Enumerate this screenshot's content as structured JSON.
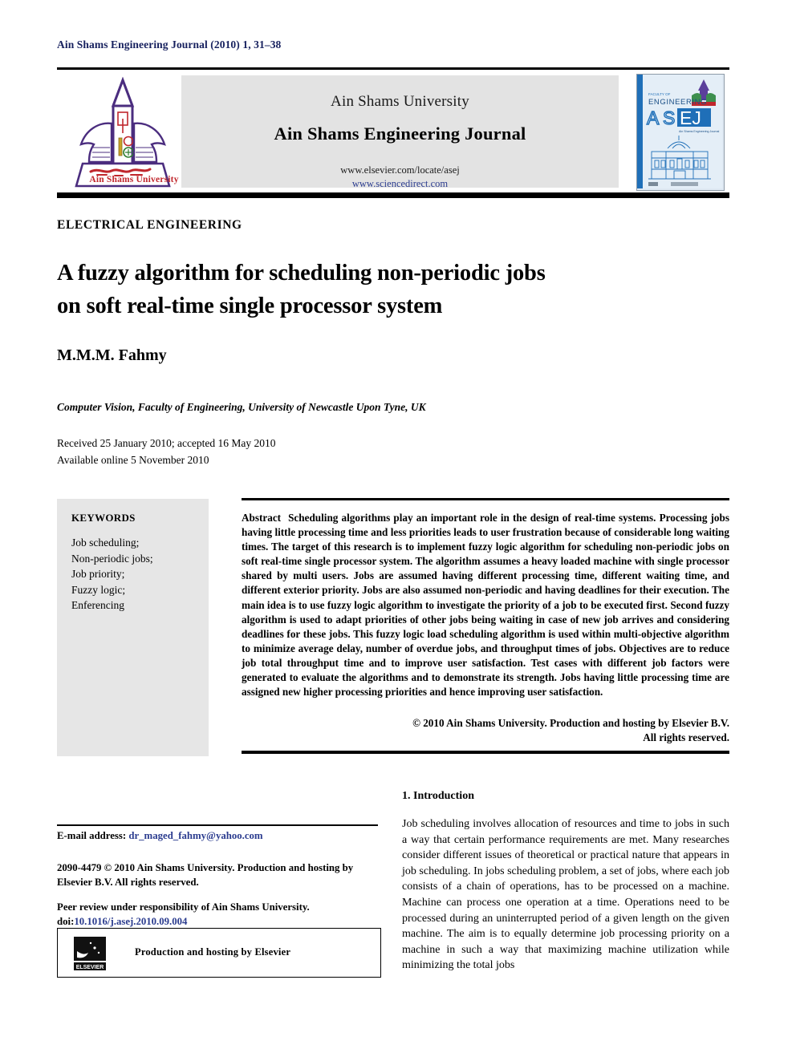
{
  "running_head": "Ain Shams Engineering Journal (2010) 1, 31–38",
  "masthead": {
    "university": "Ain Shams University",
    "journal": "Ain Shams Engineering Journal",
    "url_elsevier": "www.elsevier.com/locate/asej",
    "url_sciencedirect": "www.sciencedirect.com",
    "logo_caption_en": "Ain Shams University",
    "cover": {
      "kicker": "FACULTY OF",
      "subject": "ENGINEERING",
      "acronym_light": "AS",
      "acronym_dark": "EJ",
      "tagline": "Ain Shams Engineering Journal"
    }
  },
  "section_label": "ELECTRICAL ENGINEERING",
  "title_line1": "A fuzzy algorithm for scheduling non-periodic jobs",
  "title_line2": "on soft real-time single processor system",
  "authors": "M.M.M. Fahmy",
  "affiliation": "Computer Vision, Faculty of Engineering, University of Newcastle Upon Tyne, UK",
  "dates_line1": "Received 25 January 2010; accepted 16 May 2010",
  "dates_line2": "Available online 5 November 2010",
  "keywords": {
    "heading": "KEYWORDS",
    "items": [
      "Job scheduling;",
      "Non-periodic jobs;",
      "Job priority;",
      "Fuzzy logic;",
      "Enferencing"
    ]
  },
  "abstract": {
    "label": "Abstract",
    "text": "Scheduling algorithms play an important role in the design of real-time systems. Processing jobs having little processing time and less priorities leads to user frustration because of considerable long waiting times. The target of this research is to implement fuzzy logic algorithm for scheduling non-periodic jobs on soft real-time single processor system. The algorithm assumes a heavy loaded machine with single processor shared by multi users. Jobs are assumed having different processing time, different waiting time, and different exterior priority. Jobs are also assumed non-periodic and having deadlines for their execution. The main idea is to use fuzzy logic algorithm to investigate the priority of a job to be executed first. Second fuzzy algorithm is used to adapt priorities of other jobs being waiting in case of new job arrives and considering deadlines for these jobs. This fuzzy logic load scheduling algorithm is used within multi-objective algorithm to minimize average delay, number of overdue jobs, and throughput times of jobs. Objectives are to reduce job total throughput time and to improve user satisfaction. Test cases with different job factors were generated to evaluate the algorithms and to demonstrate its strength. Jobs having little processing time are assigned new higher processing priorities and hence improving user satisfaction.",
    "copyright_line1": "© 2010 Ain Shams University. Production and hosting by Elsevier B.V.",
    "copyright_line2": "All rights reserved."
  },
  "footer": {
    "email_label": "E-mail address:",
    "email": "dr_maged_fahmy@yahoo.com",
    "issn_line": "2090-4479 © 2010 Ain Shams University. Production and hosting by Elsevier B.V. All rights reserved.",
    "peer_review": "Peer review under responsibility of Ain Shams University.",
    "doi_label": "doi:",
    "doi": "10.1016/j.asej.2010.09.004",
    "elsevier_box_text": "Production and hosting by Elsevier",
    "elsevier_wordmark": "ELSEVIER"
  },
  "introduction": {
    "heading": "1. Introduction",
    "body": "Job scheduling involves allocation of resources and time to jobs in such a way that certain performance requirements are met. Many researches consider different issues of theoretical or practical nature that appears in job scheduling. In jobs scheduling problem, a set of jobs, where each job consists of a chain of operations, has to be processed on a machine. Machine can process one operation at a time. Operations need to be processed during an uninterrupted period of a given length on the given machine. The aim is to equally determine job processing priority on a machine in such a way that maximizing machine utilization while minimizing the total jobs"
  },
  "colors": {
    "running_head": "#16205e",
    "link": "#2b3c8f",
    "panel_gray": "#e3e3e3",
    "keywords_gray": "#e6e6e6",
    "logo_purple": "#4b2d7f",
    "logo_red": "#c0272d",
    "cover_blue": "#1f6fb8"
  }
}
